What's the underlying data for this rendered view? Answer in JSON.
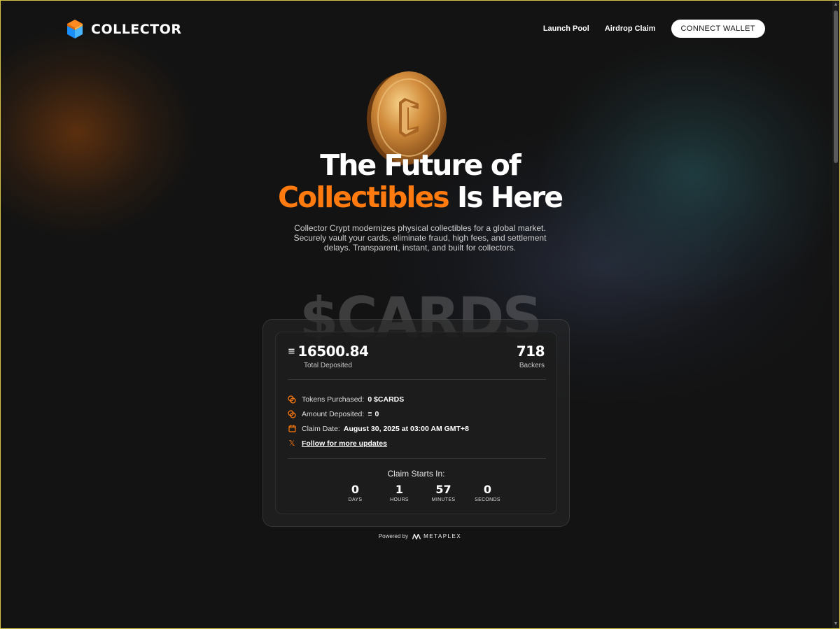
{
  "header": {
    "logo_text": "COLLECTOR",
    "nav": [
      {
        "label": "Launch Pool"
      },
      {
        "label": "Airdrop Claim"
      }
    ],
    "connect_label": "CONNECT WALLET"
  },
  "hero": {
    "headline_line1": "The Future of",
    "headline_accent": "Collectibles",
    "headline_rest": " Is Here",
    "subtitle": "Collector Crypt modernizes physical collectibles for a global market. Securely vault your cards, eliminate fraud, high fees, and settlement delays. Transparent, instant, and built for collectors.",
    "watermark": "$CARDS"
  },
  "pool": {
    "total_deposited": "16500.84",
    "total_deposited_label": "Total Deposited",
    "backers": "718",
    "backers_label": "Backers",
    "info": {
      "tokens_label": "Tokens Purchased:",
      "tokens_value": "0 $CARDS",
      "amount_label": "Amount Deposited:",
      "amount_value": "0",
      "claim_label": "Claim Date:",
      "claim_value": "August 30, 2025 at 03:00 AM GMT+8",
      "follow_label": "Follow for more updates"
    },
    "countdown": {
      "title": "Claim Starts In:",
      "units": [
        {
          "value": "0",
          "label": "DAYS"
        },
        {
          "value": "1",
          "label": "HOURS"
        },
        {
          "value": "57",
          "label": "MINUTES"
        },
        {
          "value": "0",
          "label": "SECONDS"
        }
      ]
    }
  },
  "footer": {
    "powered_by": "Powered by",
    "brand": "METAPLEX"
  },
  "colors": {
    "accent": "#ff7a0f",
    "background": "#131313"
  },
  "icons": [
    "logo-mark-icon",
    "coin-icon",
    "solana-icon",
    "coins-icon",
    "calendar-icon",
    "x-icon",
    "metaplex-icon"
  ]
}
